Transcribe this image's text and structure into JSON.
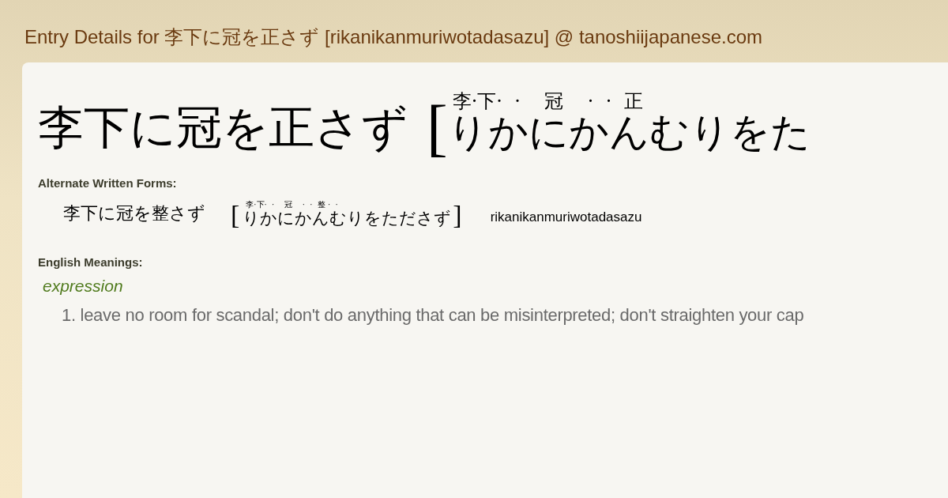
{
  "page_title": "Entry Details for 李下に冠を正さず [rikanikanmuriwotadasazu] @ tanoshiijapanese.com",
  "entry": {
    "word": "李下に冠を正さず",
    "open_bracket": "[",
    "furigana": "李·下·  ·    冠    ·  ·  正",
    "reading": "りかにかんむりをた"
  },
  "alternate_forms": {
    "heading": "Alternate Written Forms:",
    "items": [
      {
        "word": "李下に冠を整さず",
        "open_bracket": "[",
        "furigana": "李·下·  ·    冠    ·  ·  整 ·  ·",
        "reading": "りかにかんむりをたださず",
        "close_bracket": "]",
        "romaji": "rikanikanmuriwotadasazu"
      }
    ]
  },
  "meanings": {
    "heading": "English Meanings:",
    "part_of_speech": "expression",
    "items": [
      "1. leave no room for scandal; don't do anything that can be misinterpreted; don't straighten your cap"
    ]
  }
}
